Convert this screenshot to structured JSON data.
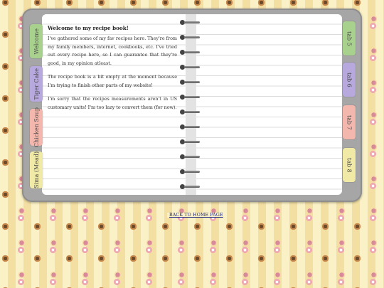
{
  "welcome_title": "Welcome to my recipe book!",
  "paragraphs": [
    "I've gathered some of my fav recipes here. They're from my family members, internet, cookbooks, etc. I've tried out every recipe here, so I can guarantee that they're good, in my opinion atleast.",
    "The recipe book is a bit empty at the moment because I'm trying to finish other parts of my website!",
    "I'm sorry that the recipes measurements aren't in US customary units! I'm too lazy to convert them (for now)."
  ],
  "left_tabs": [
    {
      "label": "Welcome",
      "color": "#a9d18e"
    },
    {
      "label": "Tiger Cake",
      "color": "#b7a9dd"
    },
    {
      "label": "Chicken Soup",
      "color": "#f3b7ad"
    },
    {
      "label": "Sima (Mead)",
      "color": "#f1eaa7"
    }
  ],
  "right_tabs": [
    {
      "label": "tab 5",
      "color": "#a9d18e"
    },
    {
      "label": "tab 6",
      "color": "#b7a9dd"
    },
    {
      "label": "tab 7",
      "color": "#f3b7ad"
    },
    {
      "label": "tab 8",
      "color": "#f1eaa7"
    }
  ],
  "back_link": "BACK TO HOME PAGE"
}
